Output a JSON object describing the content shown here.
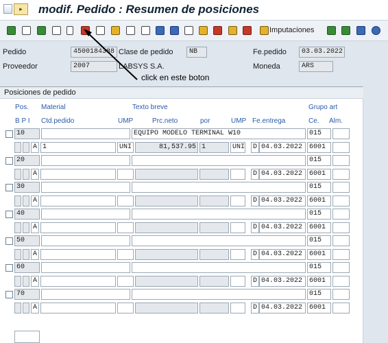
{
  "title": "modif. Pedido : Resumen de posiciones",
  "toolbar": {
    "imputaciones_label": "Imputaciones"
  },
  "header": {
    "pedido_label": "Pedido",
    "pedido_value": "4500184388",
    "clase_label": "Clase de pedido",
    "clase_value": "NB",
    "fe_pedido_label": "Fe.pedido",
    "fe_pedido_value": "03.03.2022",
    "proveedor_label": "Proveedor",
    "proveedor_value": "2007",
    "proveedor_name": "LABSYS S.A.",
    "moneda_label": "Moneda",
    "moneda_value": "ARS"
  },
  "annotation": "click en este boton",
  "panel": {
    "title": "Posiciones de pedido",
    "headers": {
      "pos": "Pos.",
      "material": "Material",
      "texto_breve": "Texto breve",
      "grupo_art": "Grupo art",
      "bpi": "B P I",
      "ctd_pedido": "Ctd.pedido",
      "ump1": "UMP",
      "prc_neto": "Prc.neto",
      "por": "por",
      "ump2": "UMP",
      "fe_entrega": "Fe.entrega",
      "ce": "Ce.",
      "alm": "Alm."
    },
    "items": [
      {
        "pos": "10",
        "texto": "EQUIPO MODELO TERMINAL W10",
        "grupo": "015",
        "i": "A",
        "ctd": "1",
        "ump": "UNI",
        "prc": "81,537.95",
        "por": "1",
        "ump2": "UNI",
        "d": "D",
        "fecha": "04.03.2022",
        "ce": "6001"
      },
      {
        "pos": "20",
        "texto": "",
        "grupo": "015",
        "i": "A",
        "ctd": "",
        "ump": "",
        "prc": "",
        "por": "",
        "ump2": "",
        "d": "D",
        "fecha": "04.03.2022",
        "ce": "6001"
      },
      {
        "pos": "30",
        "texto": "",
        "grupo": "015",
        "i": "A",
        "ctd": "",
        "ump": "",
        "prc": "",
        "por": "",
        "ump2": "",
        "d": "D",
        "fecha": "04.03.2022",
        "ce": "6001"
      },
      {
        "pos": "40",
        "texto": "",
        "grupo": "015",
        "i": "A",
        "ctd": "",
        "ump": "",
        "prc": "",
        "por": "",
        "ump2": "",
        "d": "D",
        "fecha": "04.03.2022",
        "ce": "6001"
      },
      {
        "pos": "50",
        "texto": "",
        "grupo": "015",
        "i": "A",
        "ctd": "",
        "ump": "",
        "prc": "",
        "por": "",
        "ump2": "",
        "d": "D",
        "fecha": "04.03.2022",
        "ce": "6001"
      },
      {
        "pos": "60",
        "texto": "",
        "grupo": "015",
        "i": "A",
        "ctd": "",
        "ump": "",
        "prc": "",
        "por": "",
        "ump2": "",
        "d": "D",
        "fecha": "04.03.2022",
        "ce": "6001"
      },
      {
        "pos": "70",
        "texto": "",
        "grupo": "015",
        "i": "A",
        "ctd": "",
        "ump": "",
        "prc": "",
        "por": "",
        "ump2": "",
        "d": "D",
        "fecha": "04.03.2022",
        "ce": "6001"
      }
    ]
  }
}
